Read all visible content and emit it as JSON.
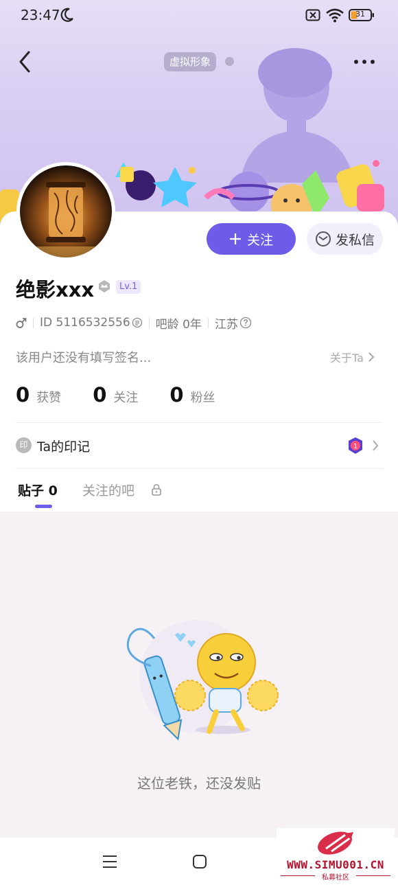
{
  "status_bar": {
    "time": "23:47",
    "battery_level": "31",
    "icons": [
      "moon-icon",
      "sim-off-icon",
      "wifi-icon",
      "battery-icon"
    ]
  },
  "header": {
    "avatar_chip": "虚拟形象",
    "icons": [
      "back-icon",
      "more-icon"
    ]
  },
  "profile": {
    "username": "绝影xxx",
    "level": "Lv.1",
    "id_text": "ID 5116532556",
    "age_text": "吧龄 0年",
    "location": "江苏",
    "signature": "该用户还没有填写签名...",
    "about_label": "关于Ta"
  },
  "actions": {
    "follow_label": "关注",
    "message_label": "发私信"
  },
  "stats": [
    {
      "value": "0",
      "label": "获赞"
    },
    {
      "value": "0",
      "label": "关注"
    },
    {
      "value": "0",
      "label": "粉丝"
    }
  ],
  "mark": {
    "icon_text": "印",
    "label": "Ta的印记",
    "badge_value": "1"
  },
  "tabs": [
    {
      "label": "贴子 0",
      "active": true
    },
    {
      "label": "关注的吧",
      "active": false
    }
  ],
  "empty_state": {
    "text": "这位老铁，还没发贴"
  },
  "watermark": {
    "text": "WWW.SIMU001.CN",
    "subtext": "私募社区"
  },
  "colors": {
    "accent": "#6c5ce7",
    "banner": "#d9cdf3",
    "content_bg": "#f6f1f5"
  }
}
